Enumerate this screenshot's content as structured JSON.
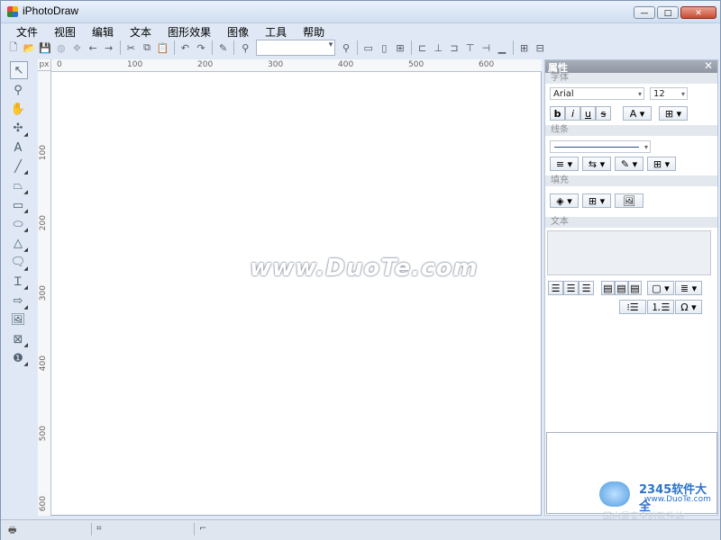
{
  "window": {
    "title": "iPhotoDraw",
    "controls": [
      "—",
      "□",
      "✕"
    ]
  },
  "menu": [
    "文件",
    "视图",
    "编辑",
    "文本",
    "图形效果",
    "图像",
    "工具",
    "帮助"
  ],
  "toolbar": {
    "zoom_value": ""
  },
  "ruler": {
    "unit": "px",
    "top_labels": [
      "0",
      "100",
      "200",
      "300",
      "400",
      "500",
      "600"
    ],
    "left_labels": [
      "100",
      "200",
      "300",
      "400",
      "500",
      "600"
    ]
  },
  "canvas": {
    "watermark": "www.DuoTe.com"
  },
  "panel": {
    "title": "属性",
    "close": "✕",
    "font_section": "字体",
    "font_name": "Arial",
    "font_size": "12",
    "line_section": "线条",
    "fill_section": "填充",
    "text_section": "文本"
  },
  "logo": {
    "brand": "2345软件大全",
    "url": "www.DuoTe.com",
    "sub": "国内最安全的软件站"
  }
}
